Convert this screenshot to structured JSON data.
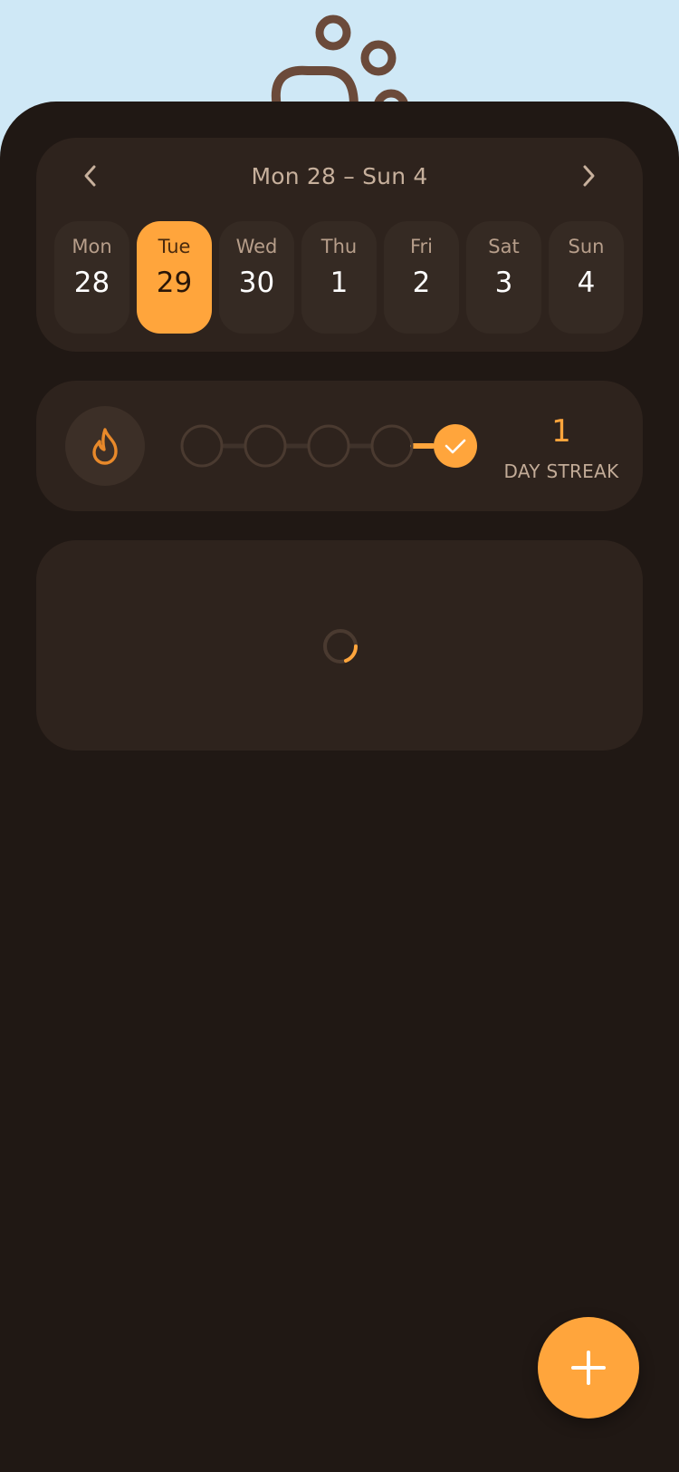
{
  "colors": {
    "accent": "#ffa53c",
    "background": "#201814",
    "card": "#2e231d",
    "sky": "#cfe8f6"
  },
  "header": {
    "illustration_icon": "bubbles-illustration"
  },
  "week": {
    "range_label": "Mon 28 – Sun 4",
    "prev_icon": "chevron-left-icon",
    "next_icon": "chevron-right-icon",
    "days": [
      {
        "name": "Mon",
        "number": "28",
        "selected": false
      },
      {
        "name": "Tue",
        "number": "29",
        "selected": true
      },
      {
        "name": "Wed",
        "number": "30",
        "selected": false
      },
      {
        "name": "Thu",
        "number": "1",
        "selected": false
      },
      {
        "name": "Fri",
        "number": "2",
        "selected": false
      },
      {
        "name": "Sat",
        "number": "3",
        "selected": false
      },
      {
        "name": "Sun",
        "number": "4",
        "selected": false
      }
    ]
  },
  "streak": {
    "icon": "flame-icon",
    "count": "1",
    "label": "DAY STREAK",
    "progress": [
      false,
      false,
      false,
      false,
      true
    ]
  },
  "loading": {
    "icon": "loading-spinner-icon"
  },
  "fab": {
    "icon": "plus-icon"
  }
}
